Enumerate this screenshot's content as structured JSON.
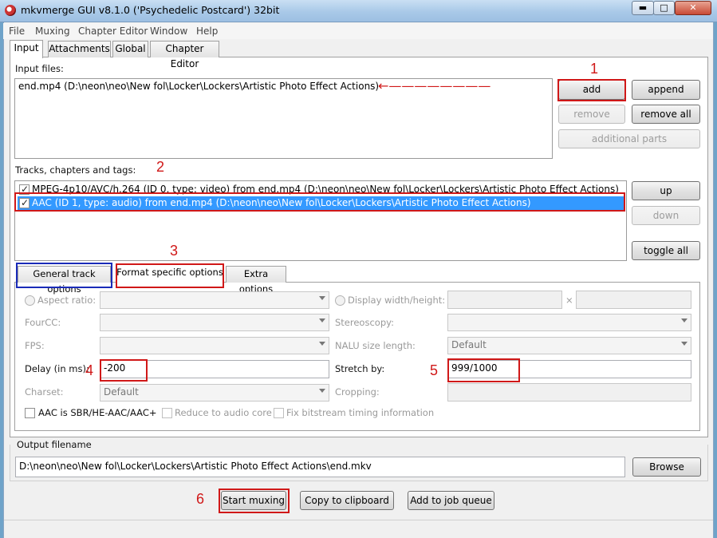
{
  "window": {
    "title": "mkvmerge GUI v8.1.0 ('Psychedelic Postcard') 32bit",
    "minimize": "▬",
    "maximize": "□",
    "close": "✕"
  },
  "menu": [
    "File",
    "Muxing",
    "Chapter Editor",
    "Window",
    "Help"
  ],
  "tabs": [
    "Input",
    "Attachments",
    "Global",
    "Chapter Editor"
  ],
  "input": {
    "input_files_label": "Input files:",
    "files": [
      "end.mp4 (D:\\neon\\neo\\New fol\\Locker\\Lockers\\Artistic Photo Effect Actions)"
    ],
    "buttons": {
      "add": "add",
      "append": "append",
      "remove": "remove",
      "remove_all": "remove all",
      "additional_parts": "additional parts"
    },
    "tracks_label": "Tracks, chapters and tags:",
    "tracks": [
      {
        "text": "MPEG-4p10/AVC/h.264 (ID 0, type: video) from end.mp4 (D:\\neon\\neo\\New fol\\Locker\\Lockers\\Artistic Photo Effect Actions)",
        "checked": true,
        "selected": false
      },
      {
        "text": "AAC (ID 1, type: audio) from end.mp4 (D:\\neon\\neo\\New fol\\Locker\\Lockers\\Artistic Photo Effect Actions)",
        "checked": true,
        "selected": true
      }
    ],
    "track_buttons": {
      "up": "up",
      "down": "down",
      "toggle_all": "toggle all"
    }
  },
  "subtabs": [
    "General track options",
    "Format specific options",
    "Extra options"
  ],
  "format": {
    "aspect_ratio_label": "Aspect ratio:",
    "display_wh_label": "Display width/height:",
    "times_sign": "×",
    "fourcc_label": "FourCC:",
    "stereoscopy_label": "Stereoscopy:",
    "fps_label": "FPS:",
    "nalu_label": "NALU size length:",
    "nalu_value": "Default",
    "delay_label": "Delay (in ms):",
    "delay_value": "-200",
    "stretch_label": "Stretch by:",
    "stretch_value": "999/1000",
    "charset_label": "Charset:",
    "charset_value": "Default",
    "cropping_label": "Cropping:",
    "aac_sbr_label": "AAC is SBR/HE-AAC/AAC+",
    "reduce_label": "Reduce to audio core",
    "fix_bitstream_label": "Fix bitstream timing information"
  },
  "output": {
    "label": "Output filename",
    "value": "D:\\neon\\neo\\New fol\\Locker\\Lockers\\Artistic Photo Effect Actions\\end.mkv",
    "browse": "Browse"
  },
  "actions": {
    "start": "Start muxing",
    "copy": "Copy to clipboard",
    "queue": "Add to job queue"
  },
  "annotations": [
    "1",
    "2",
    "3",
    "4",
    "5",
    "6"
  ],
  "colors": {
    "annotation": "#d01818",
    "highlight_blue": "#1a2bb8",
    "selection": "#3399ff"
  }
}
